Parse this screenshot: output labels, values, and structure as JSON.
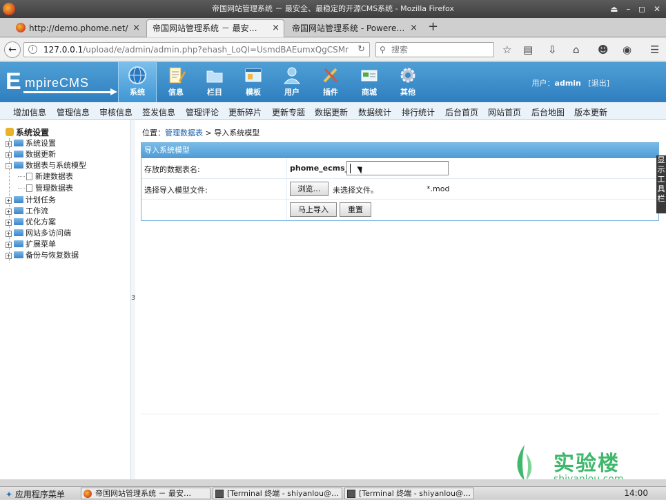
{
  "window": {
    "title": "帝国网站管理系统 － 最安全、最稳定的开源CMS系统 - Mozilla Firefox",
    "controls": "⏏ – ◻ ✕"
  },
  "tabs": [
    {
      "label": "http://demo.phome.net/",
      "close": "×"
    },
    {
      "label": "帝国网站管理系统 － 最安…",
      "close": "×"
    },
    {
      "label": "帝国网站管理系统 - Powere…",
      "close": "×"
    }
  ],
  "new_tab": "+",
  "nav": {
    "url_host": "127.0.0.1",
    "url_path": "/upload/e/admin/admin.php?ehash_LoQI=UsmdBAEumxQgCSMr",
    "search_placeholder": "搜索"
  },
  "cms": {
    "logo_first": "E",
    "logo_rest": "mpireCMS",
    "modules": [
      "系统",
      "信息",
      "栏目",
      "模板",
      "用户",
      "插件",
      "商城",
      "其他"
    ],
    "active_module": "系统",
    "user_label": "用户：",
    "user_name": "admin",
    "logout": "[退出]"
  },
  "menubar": [
    "增加信息",
    "管理信息",
    "审核信息",
    "签发信息",
    "管理评论",
    "更新碎片",
    "更新专题",
    "数据更新",
    "数据统计",
    "排行统计",
    "后台首页",
    "网站首页",
    "后台地图",
    "版本更新"
  ],
  "tree": {
    "root": "系统设置",
    "items": [
      {
        "label": "系统设置",
        "pm": "+"
      },
      {
        "label": "数据更新",
        "pm": "+"
      },
      {
        "label": "数据表与系统模型",
        "pm": "-"
      },
      {
        "label": "新建数据表"
      },
      {
        "label": "管理数据表"
      },
      {
        "label": "计划任务",
        "pm": "+"
      },
      {
        "label": "工作流",
        "pm": "+"
      },
      {
        "label": "优化方案",
        "pm": "+"
      },
      {
        "label": "网站多访问端",
        "pm": "+"
      },
      {
        "label": "扩展菜单",
        "pm": "+"
      },
      {
        "label": "备份与恢复数据",
        "pm": "+"
      }
    ]
  },
  "splitter_label": "3",
  "breadcrumb": {
    "prefix": "位置：",
    "link": "管理数据表",
    "sep": " > ",
    "current": "导入系统模型"
  },
  "form": {
    "title": "导入系统模型",
    "row1_label": "存放的数据表名:",
    "table_prefix": "phome_ecms_",
    "table_value": "",
    "row2_label": "选择导入模型文件:",
    "browse": "浏览…",
    "no_file": "未选择文件。",
    "ext": "*.mod",
    "submit": "马上导入",
    "reset": "重置"
  },
  "sidetab": "显示工具栏",
  "watermark": {
    "cn": "实验楼",
    "en": "shiyanlou.com"
  },
  "taskbar": {
    "start": "应用程序菜单",
    "items": [
      "帝国网站管理系统 － 最安…",
      "[Terminal 终端 - shiyanlou@…",
      "[Terminal 终端 - shiyanlou@…"
    ],
    "clock": "14:00"
  }
}
